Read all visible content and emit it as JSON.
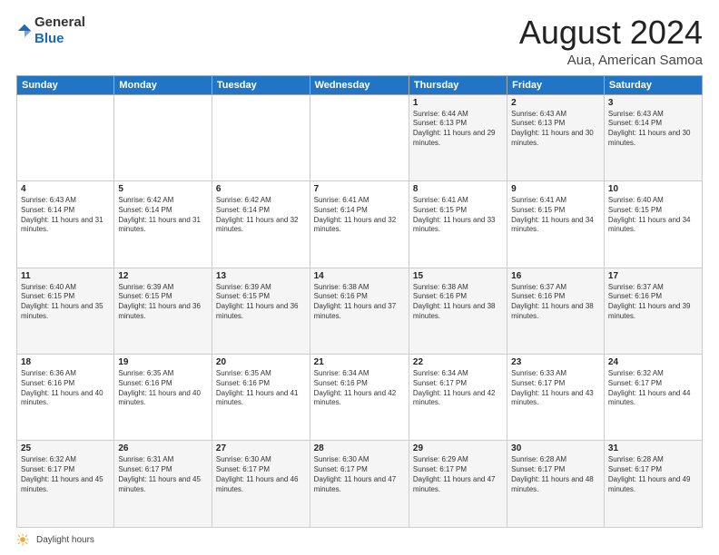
{
  "header": {
    "logo_general": "General",
    "logo_blue": "Blue",
    "month_title": "August 2024",
    "location": "Aua, American Samoa"
  },
  "weekdays": [
    "Sunday",
    "Monday",
    "Tuesday",
    "Wednesday",
    "Thursday",
    "Friday",
    "Saturday"
  ],
  "footer": {
    "daylight_label": "Daylight hours"
  },
  "weeks": [
    [
      {
        "day": "",
        "sunrise": "",
        "sunset": "",
        "daylight": ""
      },
      {
        "day": "",
        "sunrise": "",
        "sunset": "",
        "daylight": ""
      },
      {
        "day": "",
        "sunrise": "",
        "sunset": "",
        "daylight": ""
      },
      {
        "day": "",
        "sunrise": "",
        "sunset": "",
        "daylight": ""
      },
      {
        "day": "1",
        "sunrise": "Sunrise: 6:44 AM",
        "sunset": "Sunset: 6:13 PM",
        "daylight": "Daylight: 11 hours and 29 minutes."
      },
      {
        "day": "2",
        "sunrise": "Sunrise: 6:43 AM",
        "sunset": "Sunset: 6:13 PM",
        "daylight": "Daylight: 11 hours and 30 minutes."
      },
      {
        "day": "3",
        "sunrise": "Sunrise: 6:43 AM",
        "sunset": "Sunset: 6:14 PM",
        "daylight": "Daylight: 11 hours and 30 minutes."
      }
    ],
    [
      {
        "day": "4",
        "sunrise": "Sunrise: 6:43 AM",
        "sunset": "Sunset: 6:14 PM",
        "daylight": "Daylight: 11 hours and 31 minutes."
      },
      {
        "day": "5",
        "sunrise": "Sunrise: 6:42 AM",
        "sunset": "Sunset: 6:14 PM",
        "daylight": "Daylight: 11 hours and 31 minutes."
      },
      {
        "day": "6",
        "sunrise": "Sunrise: 6:42 AM",
        "sunset": "Sunset: 6:14 PM",
        "daylight": "Daylight: 11 hours and 32 minutes."
      },
      {
        "day": "7",
        "sunrise": "Sunrise: 6:41 AM",
        "sunset": "Sunset: 6:14 PM",
        "daylight": "Daylight: 11 hours and 32 minutes."
      },
      {
        "day": "8",
        "sunrise": "Sunrise: 6:41 AM",
        "sunset": "Sunset: 6:15 PM",
        "daylight": "Daylight: 11 hours and 33 minutes."
      },
      {
        "day": "9",
        "sunrise": "Sunrise: 6:41 AM",
        "sunset": "Sunset: 6:15 PM",
        "daylight": "Daylight: 11 hours and 34 minutes."
      },
      {
        "day": "10",
        "sunrise": "Sunrise: 6:40 AM",
        "sunset": "Sunset: 6:15 PM",
        "daylight": "Daylight: 11 hours and 34 minutes."
      }
    ],
    [
      {
        "day": "11",
        "sunrise": "Sunrise: 6:40 AM",
        "sunset": "Sunset: 6:15 PM",
        "daylight": "Daylight: 11 hours and 35 minutes."
      },
      {
        "day": "12",
        "sunrise": "Sunrise: 6:39 AM",
        "sunset": "Sunset: 6:15 PM",
        "daylight": "Daylight: 11 hours and 36 minutes."
      },
      {
        "day": "13",
        "sunrise": "Sunrise: 6:39 AM",
        "sunset": "Sunset: 6:15 PM",
        "daylight": "Daylight: 11 hours and 36 minutes."
      },
      {
        "day": "14",
        "sunrise": "Sunrise: 6:38 AM",
        "sunset": "Sunset: 6:16 PM",
        "daylight": "Daylight: 11 hours and 37 minutes."
      },
      {
        "day": "15",
        "sunrise": "Sunrise: 6:38 AM",
        "sunset": "Sunset: 6:16 PM",
        "daylight": "Daylight: 11 hours and 38 minutes."
      },
      {
        "day": "16",
        "sunrise": "Sunrise: 6:37 AM",
        "sunset": "Sunset: 6:16 PM",
        "daylight": "Daylight: 11 hours and 38 minutes."
      },
      {
        "day": "17",
        "sunrise": "Sunrise: 6:37 AM",
        "sunset": "Sunset: 6:16 PM",
        "daylight": "Daylight: 11 hours and 39 minutes."
      }
    ],
    [
      {
        "day": "18",
        "sunrise": "Sunrise: 6:36 AM",
        "sunset": "Sunset: 6:16 PM",
        "daylight": "Daylight: 11 hours and 40 minutes."
      },
      {
        "day": "19",
        "sunrise": "Sunrise: 6:35 AM",
        "sunset": "Sunset: 6:16 PM",
        "daylight": "Daylight: 11 hours and 40 minutes."
      },
      {
        "day": "20",
        "sunrise": "Sunrise: 6:35 AM",
        "sunset": "Sunset: 6:16 PM",
        "daylight": "Daylight: 11 hours and 41 minutes."
      },
      {
        "day": "21",
        "sunrise": "Sunrise: 6:34 AM",
        "sunset": "Sunset: 6:16 PM",
        "daylight": "Daylight: 11 hours and 42 minutes."
      },
      {
        "day": "22",
        "sunrise": "Sunrise: 6:34 AM",
        "sunset": "Sunset: 6:17 PM",
        "daylight": "Daylight: 11 hours and 42 minutes."
      },
      {
        "day": "23",
        "sunrise": "Sunrise: 6:33 AM",
        "sunset": "Sunset: 6:17 PM",
        "daylight": "Daylight: 11 hours and 43 minutes."
      },
      {
        "day": "24",
        "sunrise": "Sunrise: 6:32 AM",
        "sunset": "Sunset: 6:17 PM",
        "daylight": "Daylight: 11 hours and 44 minutes."
      }
    ],
    [
      {
        "day": "25",
        "sunrise": "Sunrise: 6:32 AM",
        "sunset": "Sunset: 6:17 PM",
        "daylight": "Daylight: 11 hours and 45 minutes."
      },
      {
        "day": "26",
        "sunrise": "Sunrise: 6:31 AM",
        "sunset": "Sunset: 6:17 PM",
        "daylight": "Daylight: 11 hours and 45 minutes."
      },
      {
        "day": "27",
        "sunrise": "Sunrise: 6:30 AM",
        "sunset": "Sunset: 6:17 PM",
        "daylight": "Daylight: 11 hours and 46 minutes."
      },
      {
        "day": "28",
        "sunrise": "Sunrise: 6:30 AM",
        "sunset": "Sunset: 6:17 PM",
        "daylight": "Daylight: 11 hours and 47 minutes."
      },
      {
        "day": "29",
        "sunrise": "Sunrise: 6:29 AM",
        "sunset": "Sunset: 6:17 PM",
        "daylight": "Daylight: 11 hours and 47 minutes."
      },
      {
        "day": "30",
        "sunrise": "Sunrise: 6:28 AM",
        "sunset": "Sunset: 6:17 PM",
        "daylight": "Daylight: 11 hours and 48 minutes."
      },
      {
        "day": "31",
        "sunrise": "Sunrise: 6:28 AM",
        "sunset": "Sunset: 6:17 PM",
        "daylight": "Daylight: 11 hours and 49 minutes."
      }
    ]
  ]
}
